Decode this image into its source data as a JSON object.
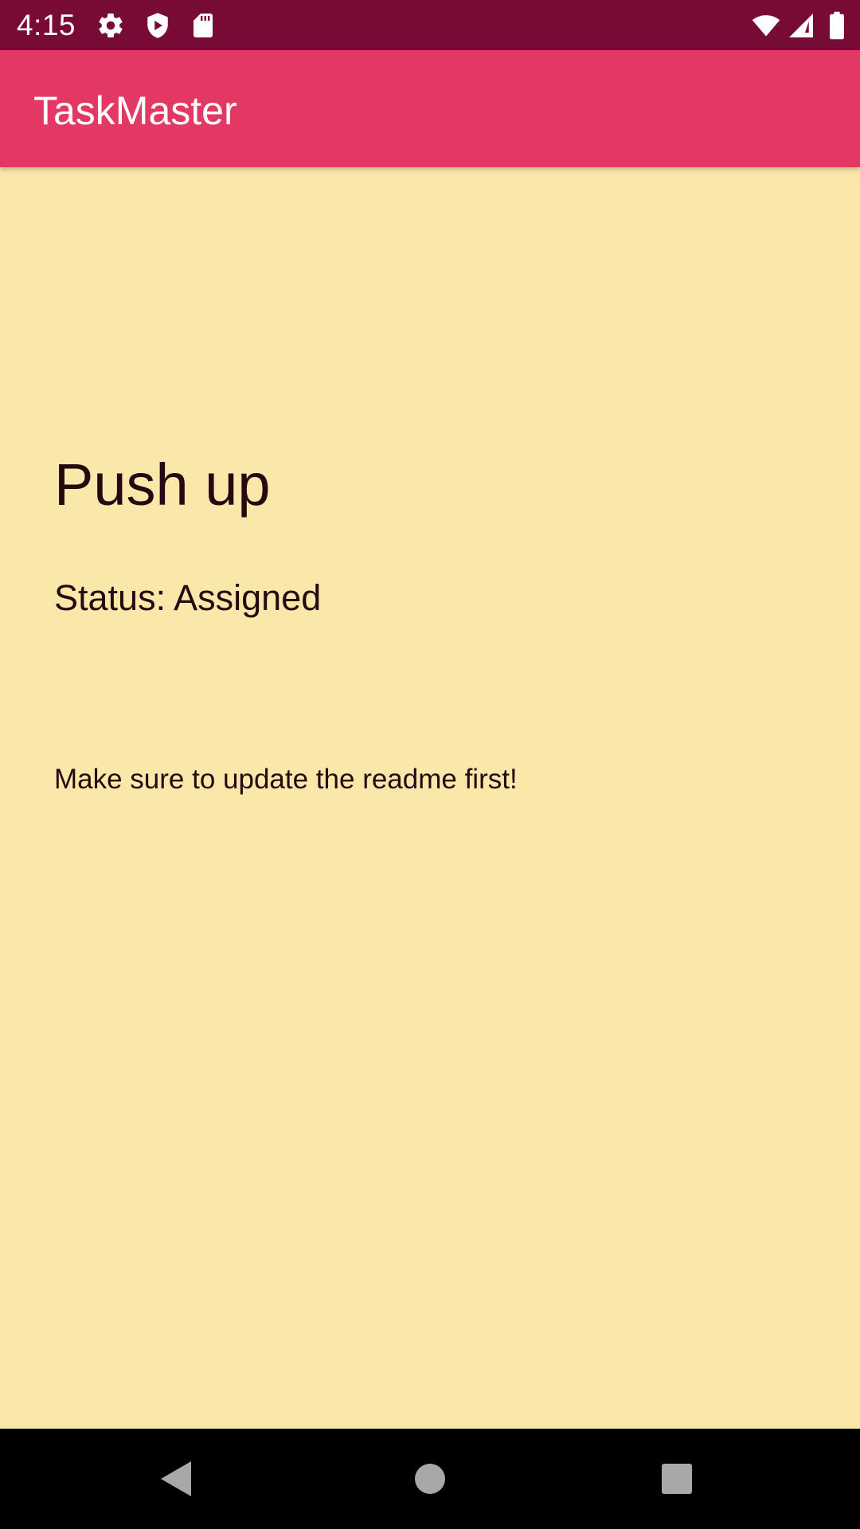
{
  "status_bar": {
    "time": "4:15",
    "icons": [
      "settings-gear-icon",
      "shield-icon",
      "sd-card-icon",
      "wifi-icon",
      "cell-signal-icon",
      "battery-icon"
    ]
  },
  "app_bar": {
    "title": "TaskMaster",
    "color": "#e43864"
  },
  "task": {
    "title": "Push up",
    "status": "Status: Assigned",
    "body": "Make sure to update the readme first!"
  },
  "nav_bar": {
    "buttons": [
      "back-icon",
      "home-icon",
      "recents-icon"
    ]
  },
  "colors": {
    "status_bar": "#780a36",
    "app_bar": "#e43864",
    "background": "#f8e8aa",
    "text": "#240a10"
  }
}
